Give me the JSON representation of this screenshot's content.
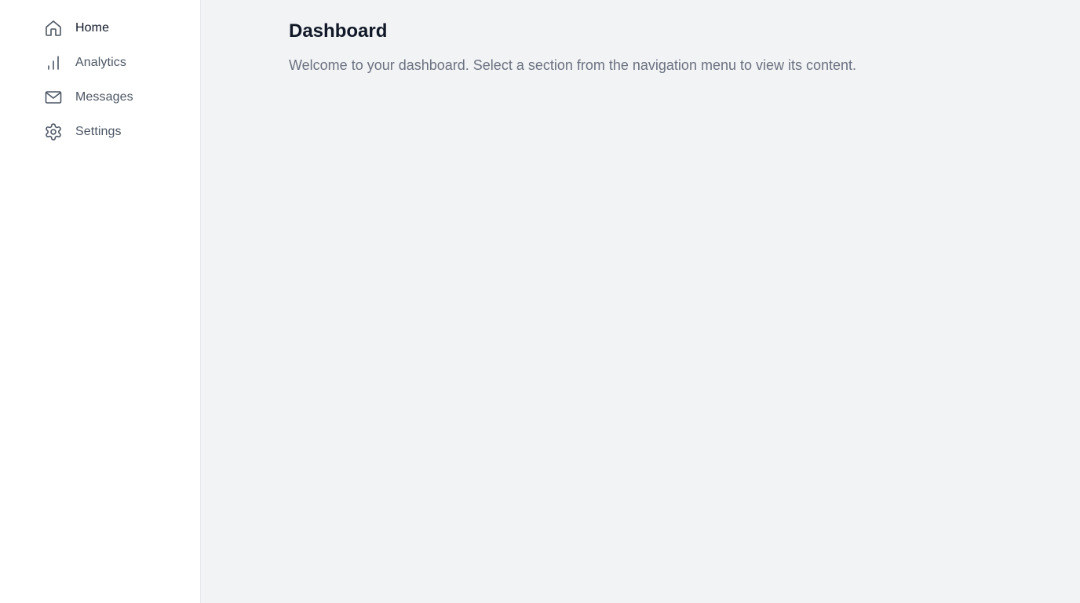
{
  "sidebar": {
    "items": [
      {
        "label": "Home",
        "icon": "home-icon",
        "active": true
      },
      {
        "label": "Analytics",
        "icon": "bar-chart-icon",
        "active": false
      },
      {
        "label": "Messages",
        "icon": "mail-icon",
        "active": false
      },
      {
        "label": "Settings",
        "icon": "gear-icon",
        "active": false
      }
    ]
  },
  "main": {
    "title": "Dashboard",
    "description": "Welcome to your dashboard. Select a section from the navigation menu to view its content."
  },
  "colors": {
    "sidebar_bg": "#ffffff",
    "main_bg": "#f2f3f5",
    "title_text": "#111827",
    "muted_text": "#6b7280",
    "nav_text": "#4b5563"
  }
}
